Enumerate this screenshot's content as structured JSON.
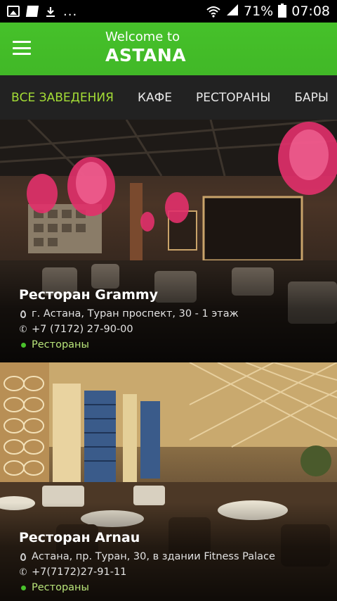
{
  "status_bar": {
    "battery": "71%",
    "time": "07:08",
    "overflow": "..."
  },
  "header": {
    "welcome": "Welcome to",
    "city": "ASTANA"
  },
  "tabs": [
    {
      "label": "ВСЕ ЗАВЕДЕНИЯ",
      "active": true
    },
    {
      "label": "КАФЕ",
      "active": false
    },
    {
      "label": "РЕСТОРАНЫ",
      "active": false
    },
    {
      "label": "БАРЫ",
      "active": false
    }
  ],
  "venues": [
    {
      "name": "Ресторан Grammy",
      "address": "г. Астана, Туран проспект, 30 - 1 этаж",
      "phone": "+7 (7172) 27-90-00",
      "category": "Рестораны"
    },
    {
      "name": "Ресторан Arnau",
      "address": "Астана, пр. Туран, 30, в здании Fitness Palace",
      "phone": "+7(7172)27-91-11",
      "category": "Рестораны"
    }
  ],
  "colors": {
    "header_green": "#43bb28",
    "active_tab": "#a4dd36",
    "category_dot": "#49c12b"
  }
}
